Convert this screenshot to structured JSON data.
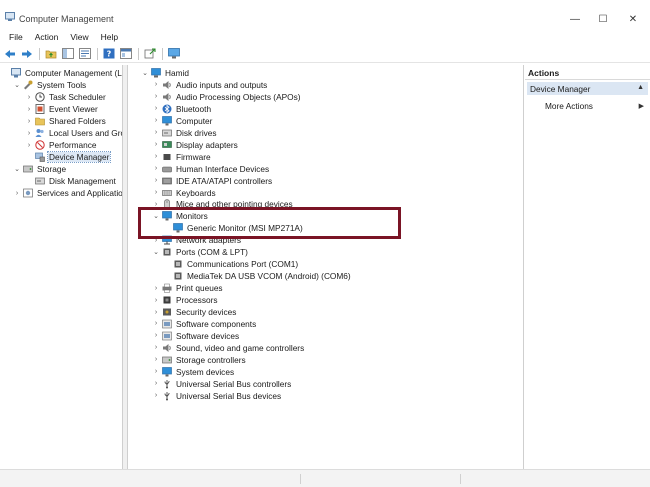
{
  "window": {
    "title": "Computer Management",
    "min_glyph": "—",
    "max_glyph": "☐",
    "close_glyph": "✕"
  },
  "menu": [
    "File",
    "Action",
    "View",
    "Help"
  ],
  "toolbar_icons": [
    "back-arrow-icon",
    "forward-arrow-icon",
    "up-folder-icon",
    "show-hide-tree-icon",
    "properties-icon",
    "help-icon",
    "console-icon",
    "export-icon",
    "monitor-icon"
  ],
  "left_tree": [
    {
      "label": "Computer Management (Local",
      "icon": "computer-management-icon",
      "depth": 0,
      "expander": "",
      "selected": false
    },
    {
      "label": "System Tools",
      "icon": "system-tools-icon",
      "depth": 1,
      "expander": "down",
      "selected": false
    },
    {
      "label": "Task Scheduler",
      "icon": "clock-icon",
      "depth": 2,
      "expander": "right",
      "selected": false
    },
    {
      "label": "Event Viewer",
      "icon": "event-viewer-icon",
      "depth": 2,
      "expander": "right",
      "selected": false
    },
    {
      "label": "Shared Folders",
      "icon": "shared-folder-icon",
      "depth": 2,
      "expander": "right",
      "selected": false
    },
    {
      "label": "Local Users and Groups",
      "icon": "users-icon",
      "depth": 2,
      "expander": "right",
      "selected": false
    },
    {
      "label": "Performance",
      "icon": "performance-icon",
      "depth": 2,
      "expander": "right",
      "selected": false
    },
    {
      "label": "Device Manager",
      "icon": "device-manager-icon",
      "depth": 2,
      "expander": "",
      "selected": true
    },
    {
      "label": "Storage",
      "icon": "storage-icon",
      "depth": 1,
      "expander": "down",
      "selected": false
    },
    {
      "label": "Disk Management",
      "icon": "disk-icon",
      "depth": 2,
      "expander": "",
      "selected": false
    },
    {
      "label": "Services and Applications",
      "icon": "services-icon",
      "depth": 1,
      "expander": "right",
      "selected": false
    }
  ],
  "device_tree": [
    {
      "label": "Hamid",
      "icon": "computer-icon",
      "depth": 0,
      "expander": "down"
    },
    {
      "label": "Audio inputs and outputs",
      "icon": "audio-icon",
      "depth": 1,
      "expander": "right"
    },
    {
      "label": "Audio Processing Objects (APOs)",
      "icon": "audio-icon",
      "depth": 1,
      "expander": "right"
    },
    {
      "label": "Bluetooth",
      "icon": "bluetooth-icon",
      "depth": 1,
      "expander": "right"
    },
    {
      "label": "Computer",
      "icon": "monitor-icon",
      "depth": 1,
      "expander": "right"
    },
    {
      "label": "Disk drives",
      "icon": "disk-icon",
      "depth": 1,
      "expander": "right"
    },
    {
      "label": "Display adapters",
      "icon": "display-adapter-icon",
      "depth": 1,
      "expander": "right"
    },
    {
      "label": "Firmware",
      "icon": "chip-icon",
      "depth": 1,
      "expander": "right"
    },
    {
      "label": "Human Interface Devices",
      "icon": "hid-icon",
      "depth": 1,
      "expander": "right"
    },
    {
      "label": "IDE ATA/ATAPI controllers",
      "icon": "controller-icon",
      "depth": 1,
      "expander": "right"
    },
    {
      "label": "Keyboards",
      "icon": "keyboard-icon",
      "depth": 1,
      "expander": "right"
    },
    {
      "label": "Mice and other pointing devices",
      "icon": "mouse-icon",
      "depth": 1,
      "expander": "right"
    },
    {
      "label": "Monitors",
      "icon": "monitor-icon",
      "depth": 1,
      "expander": "down"
    },
    {
      "label": "Generic Monitor (MSI MP271A)",
      "icon": "monitor-icon",
      "depth": 2,
      "expander": ""
    },
    {
      "label": "Network adapters",
      "icon": "network-icon",
      "depth": 1,
      "expander": "right"
    },
    {
      "label": "Ports (COM & LPT)",
      "icon": "port-icon",
      "depth": 1,
      "expander": "down"
    },
    {
      "label": "Communications Port (COM1)",
      "icon": "port-icon",
      "depth": 2,
      "expander": ""
    },
    {
      "label": "MediaTek DA USB VCOM (Android) (COM6)",
      "icon": "port-icon",
      "depth": 2,
      "expander": ""
    },
    {
      "label": "Print queues",
      "icon": "printer-icon",
      "depth": 1,
      "expander": "right"
    },
    {
      "label": "Processors",
      "icon": "processor-icon",
      "depth": 1,
      "expander": "right"
    },
    {
      "label": "Security devices",
      "icon": "security-icon",
      "depth": 1,
      "expander": "right"
    },
    {
      "label": "Software components",
      "icon": "software-icon",
      "depth": 1,
      "expander": "right"
    },
    {
      "label": "Software devices",
      "icon": "software-icon",
      "depth": 1,
      "expander": "right"
    },
    {
      "label": "Sound, video and game controllers",
      "icon": "audio-icon",
      "depth": 1,
      "expander": "right"
    },
    {
      "label": "Storage controllers",
      "icon": "storage-icon",
      "depth": 1,
      "expander": "right"
    },
    {
      "label": "System devices",
      "icon": "monitor-icon",
      "depth": 1,
      "expander": "right"
    },
    {
      "label": "Universal Serial Bus controllers",
      "icon": "usb-icon",
      "depth": 1,
      "expander": "right"
    },
    {
      "label": "Universal Serial Bus devices",
      "icon": "usb-icon",
      "depth": 1,
      "expander": "right"
    }
  ],
  "actions": {
    "header": "Actions",
    "section": "Device Manager",
    "section_arrow": "▲",
    "item": "More Actions",
    "item_arrow": "▶"
  },
  "colors": {
    "highlight_border": "#7a1425",
    "selection": "#dde8f5",
    "monitor_blue": "#2f8fd8"
  }
}
